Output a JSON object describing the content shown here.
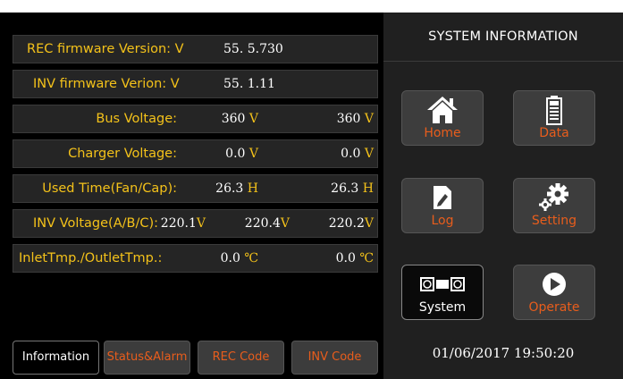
{
  "rows": [
    {
      "label": "REC firmware Version: V",
      "v1": "55.  5.730"
    },
    {
      "label": "INV firmware Verion: V",
      "v1": "55.  1.11"
    },
    {
      "label": "Bus Voltage:",
      "v1": "360",
      "u1": "V",
      "v2": "360",
      "u2": "V"
    },
    {
      "label": "Charger Voltage:",
      "v1": "0.0",
      "u1": "V",
      "v2": "0.0",
      "u2": "V"
    },
    {
      "label": "Used Time(Fan/Cap):",
      "v1": "26.3",
      "u1": "H",
      "v2": "26.3",
      "u2": "H"
    },
    {
      "label": "INV Voltage(A/B/C):",
      "v1": "220.1",
      "u1": "V",
      "v2": "220.4",
      "u2": "V",
      "v3": "220.2",
      "u3": "V"
    },
    {
      "label": "InletTmp./OutletTmp.:",
      "v1": "0.0",
      "u1": "℃",
      "v2": "0.0",
      "u2": "℃"
    }
  ],
  "tabs": [
    "Information",
    "Status&Alarm",
    "REC Code",
    "INV Code"
  ],
  "panel": {
    "title": "SYSTEM INFORMATION",
    "buttons": {
      "home": {
        "label": "Home",
        "icon": "home-icon"
      },
      "data": {
        "label": "Data",
        "icon": "battery-icon"
      },
      "log": {
        "label": "Log",
        "icon": "edit-icon"
      },
      "setting": {
        "label": "Setting",
        "icon": "gear-icon"
      },
      "system": {
        "label": "System",
        "icon": "system-icon"
      },
      "operate": {
        "label": "Operate",
        "icon": "play-icon"
      }
    },
    "datetime": "01/06/2017  19:50:20"
  },
  "colors": {
    "accent": "#f4c21a",
    "button_text": "#e85d1c"
  }
}
